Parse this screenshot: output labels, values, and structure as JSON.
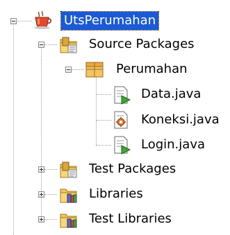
{
  "tree": {
    "project": {
      "label": "UtsPerumahan",
      "icon": "coffee-cup-icon",
      "expanded": true,
      "selected": true
    },
    "source_packages": {
      "label": "Source Packages",
      "icon": "source-folder-icon",
      "expanded": true,
      "package": {
        "label": "Perumahan",
        "icon": "package-icon",
        "expanded": true,
        "files": [
          {
            "label": "Data.java",
            "icon": "java-class-icon"
          },
          {
            "label": "Koneksi.java",
            "icon": "java-gear-class-icon"
          },
          {
            "label": "Login.java",
            "icon": "java-class-icon"
          }
        ]
      }
    },
    "test_packages": {
      "label": "Test Packages",
      "icon": "test-folder-icon",
      "expanded": false
    },
    "libraries": {
      "label": "Libraries",
      "icon": "library-folder-icon",
      "expanded": false
    },
    "test_libraries": {
      "label": "Test Libraries",
      "icon": "library-folder-icon",
      "expanded": false
    }
  },
  "colors": {
    "selection": "#1a5ad6",
    "tree_line": "#a0a0a0",
    "folder": "#e8b84a"
  }
}
